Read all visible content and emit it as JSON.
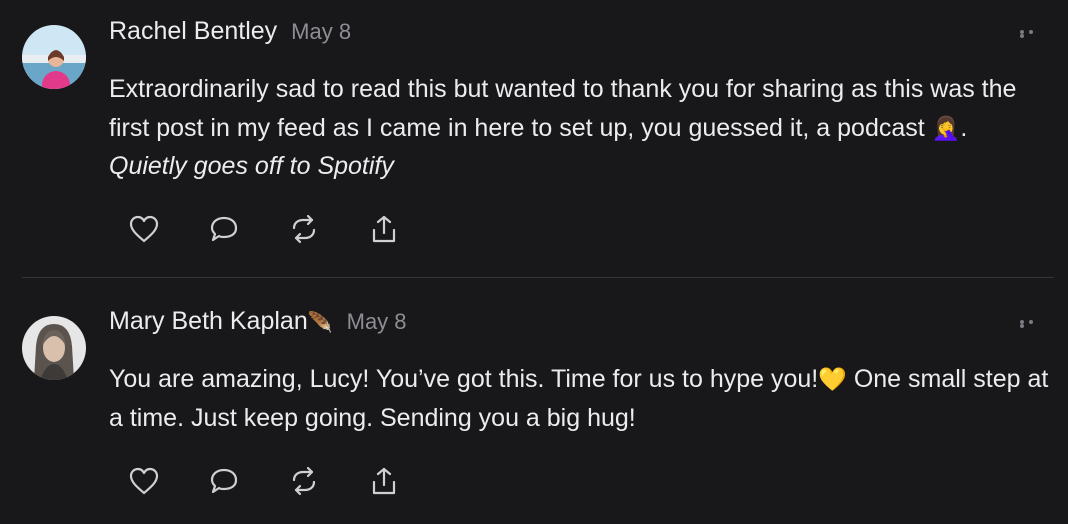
{
  "comments": [
    {
      "author": "Rachel Bentley",
      "date": "May 8",
      "text_plain": "Extraordinarily sad to read this but wanted to thank you for sharing as this was the first post in my feed as I came in here to set up, you guessed it, a podcast",
      "emoji": "🤦‍♀️",
      "text_tail": ".",
      "text_italic": "Quietly goes off to Spotify",
      "author_badge": ""
    },
    {
      "author": "Mary Beth Kaplan",
      "author_badge": "🪶",
      "date": "May 8",
      "text_plain": "You are amazing, Lucy! You’ve got this. Time for us to hype you!",
      "emoji": "💛",
      "text_tail": " One small step at a time. Just keep going. Sending you a big hug!"
    }
  ],
  "icons": {
    "like": "heart-icon",
    "reply": "comment-icon",
    "restack": "restack-icon",
    "share": "share-icon",
    "more": "more-icon"
  },
  "colors": {
    "background": "#18181b",
    "text": "#ececee",
    "muted": "#8d8d93",
    "divider": "#34343a"
  }
}
